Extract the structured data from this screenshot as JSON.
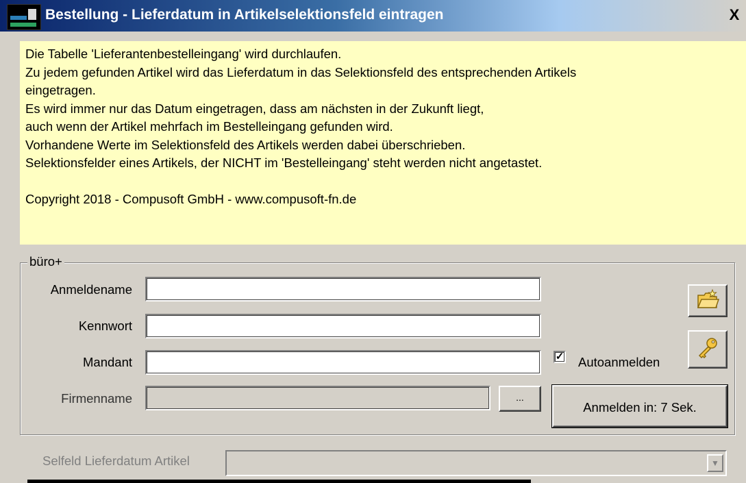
{
  "window": {
    "title": "Bestellung - Lieferdatum in Artikelselektionsfeld eintragen",
    "close_glyph": "X"
  },
  "info": {
    "lines": [
      "Die Tabelle 'Lieferantenbestelleingang' wird durchlaufen.",
      "Zu jedem gefunden Artikel wird das Lieferdatum in das Selektionsfeld des entsprechenden Artikels",
      "eingetragen.",
      "Es wird immer nur das Datum eingetragen, dass am nächsten in der Zukunft liegt,",
      "auch wenn der Artikel mehrfach im Bestelleingang gefunden wird.",
      "Vorhandene Werte im Selektionsfeld des Artikels werden dabei überschrieben.",
      "Selektionsfelder eines Artikels, der NICHT im 'Bestelleingang' steht werden nicht angetastet.",
      "",
      "Copyright 2018 - Compusoft GmbH - www.compusoft-fn.de"
    ]
  },
  "login_group": {
    "legend": "büro+",
    "anmeldename_label": "Anmeldename",
    "anmeldename_value": "",
    "kennwort_label": "Kennwort",
    "kennwort_value": "",
    "mandant_label": "Mandant",
    "mandant_value": "",
    "firmenname_label": "Firmenname",
    "firmenname_value": "",
    "browse_label": "...",
    "autoanmelden_label": "Autoanmelden",
    "autoanmelden_checked": true,
    "login_button_label": "Anmelden in: 7 Sek.",
    "icons": [
      "open-folder-icon",
      "key-icon"
    ]
  },
  "selfeld": {
    "label": "Selfeld Lieferdatum Artikel",
    "value": ""
  },
  "colors": {
    "info_background": "#ffffc2",
    "title_bar": "#0a246a",
    "window_background": "#d4d0c8",
    "disabled_text": "#808080"
  }
}
